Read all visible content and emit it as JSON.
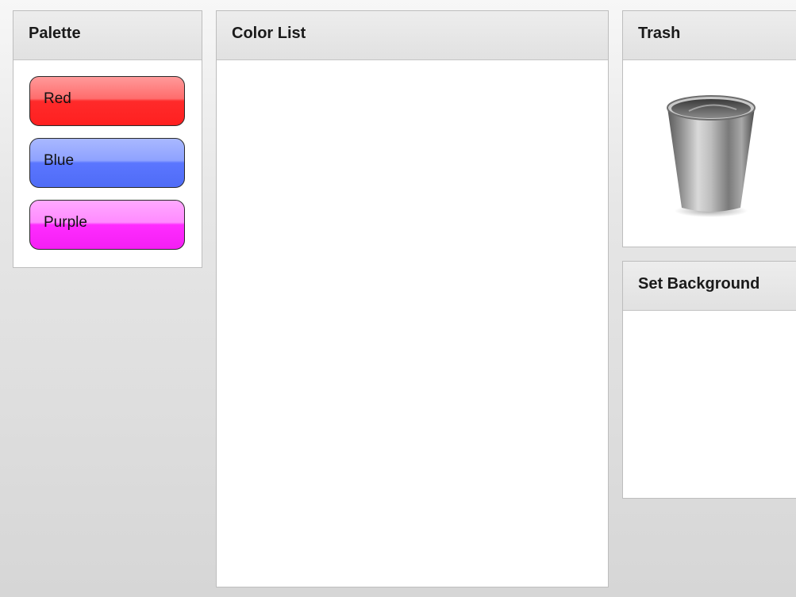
{
  "palette": {
    "title": "Palette",
    "colors": [
      {
        "label": "Red",
        "hex": "#ff2a2a"
      },
      {
        "label": "Blue",
        "hex": "#5b76ff"
      },
      {
        "label": "Purple",
        "hex": "#ff2cff"
      }
    ]
  },
  "color_list": {
    "title": "Color List",
    "items": []
  },
  "trash": {
    "title": "Trash",
    "icon": "trash-can-icon"
  },
  "set_background": {
    "title": "Set Background"
  }
}
